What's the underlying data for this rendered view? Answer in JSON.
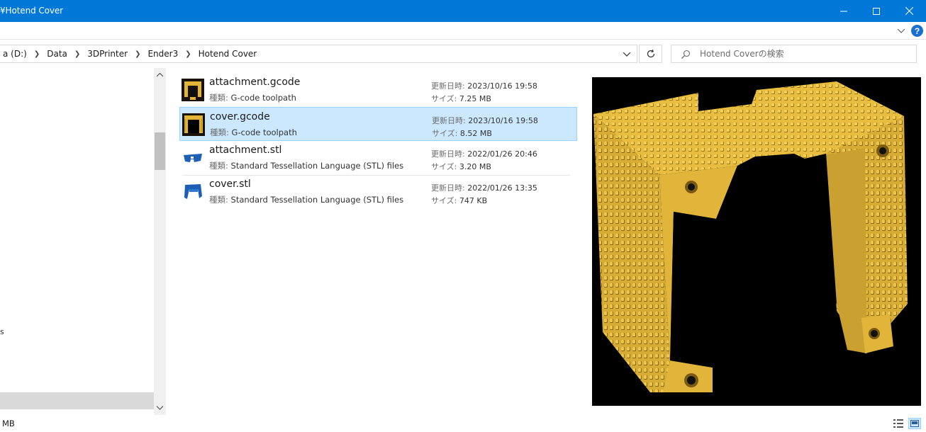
{
  "window": {
    "title": "¥Hotend Cover",
    "minimize_label": "minimize",
    "maximize_label": "maximize",
    "close_label": "close"
  },
  "address": {
    "breadcrumbs": [
      "a (D:)",
      "Data",
      "3DPrinter",
      "Ender3",
      "Hotend Cover"
    ]
  },
  "search": {
    "placeholder": "Hotend Coverの検索"
  },
  "nav": {
    "partial_item": "s"
  },
  "files": [
    {
      "name": "attachment.gcode",
      "type_label": "種類:",
      "type": "G-code toolpath",
      "modified_label": "更新日時:",
      "modified": "2023/10/16 19:58",
      "size_label": "サイズ:",
      "size": "7.25 MB",
      "icon": "gcode-thumbnail-icon",
      "selected": false
    },
    {
      "name": "cover.gcode",
      "type_label": "種類:",
      "type": "G-code toolpath",
      "modified_label": "更新日時:",
      "modified": "2023/10/16 19:58",
      "size_label": "サイズ:",
      "size": "8.52 MB",
      "icon": "gcode-thumbnail-icon",
      "selected": true
    },
    {
      "name": "attachment.stl",
      "type_label": "種類:",
      "type": "Standard Tessellation Language (STL) files",
      "modified_label": "更新日時:",
      "modified": "2022/01/26 20:46",
      "size_label": "サイズ:",
      "size": "3.20 MB",
      "icon": "stl-thumbnail-icon",
      "selected": false
    },
    {
      "name": "cover.stl",
      "type_label": "種類:",
      "type": "Standard Tessellation Language (STL) files",
      "modified_label": "更新日時:",
      "modified": "2022/01/26 13:35",
      "size_label": "サイズ:",
      "size": "747 KB",
      "icon": "stl-thumbnail-icon",
      "selected": false
    }
  ],
  "status": {
    "text": "MB"
  },
  "colors": {
    "titlebar": "#0078d7",
    "selection": "#cce8ff",
    "selection_border": "#99d1ff",
    "model_yellow": "#e0b53a",
    "stl_blue": "#1d5fb4"
  }
}
